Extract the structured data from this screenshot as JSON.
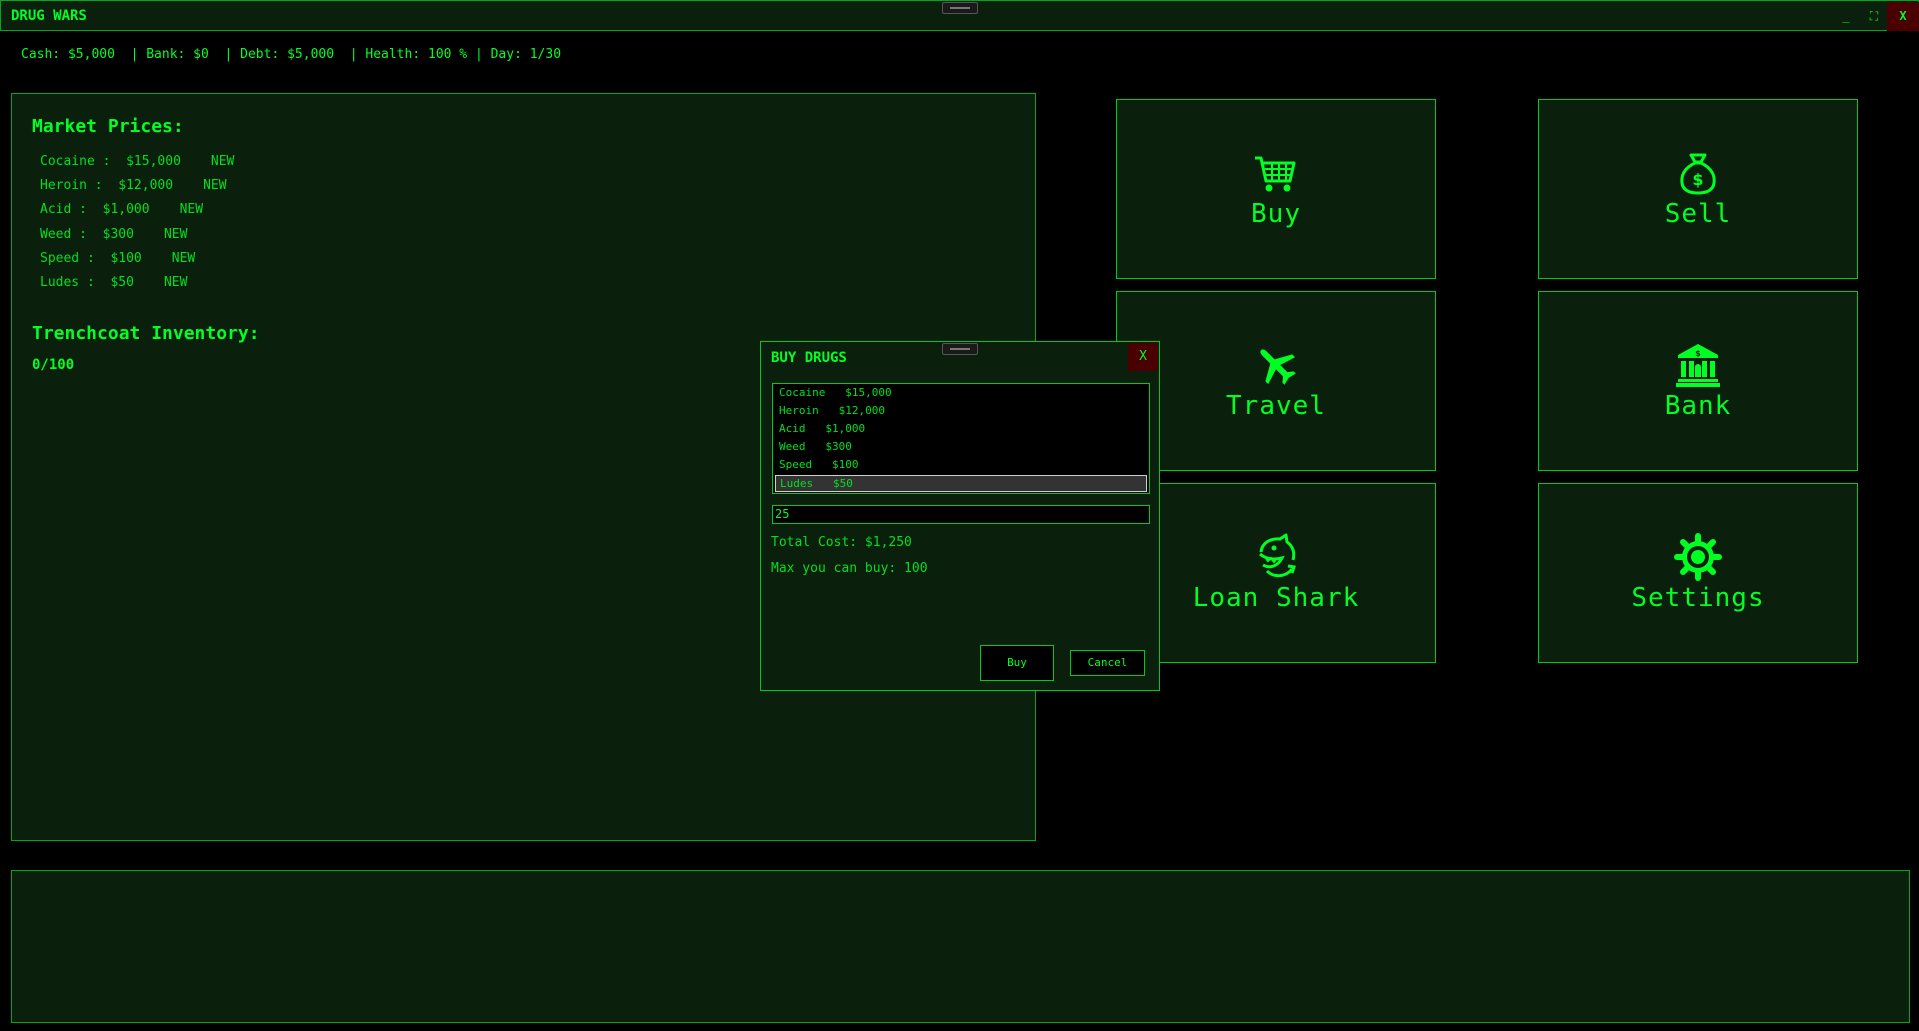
{
  "window": {
    "title": "DRUG WARS",
    "minimize_label": "_",
    "maximize_label": "⛶",
    "close_label": "X"
  },
  "status": {
    "text": "Cash: $5,000  | Bank: $0  | Debt: $5,000  | Health: 100 % | Day: 1/30"
  },
  "market": {
    "heading": "Market Prices:",
    "items": [
      {
        "name": "Cocaine :",
        "price": "$15,000",
        "tag": "NEW"
      },
      {
        "name": "Heroin :",
        "price": "$12,000",
        "tag": "NEW"
      },
      {
        "name": "Acid :",
        "price": "$1,000",
        "tag": "NEW"
      },
      {
        "name": "Weed :",
        "price": "$300",
        "tag": "NEW"
      },
      {
        "name": "Speed :",
        "price": "$100",
        "tag": "NEW"
      },
      {
        "name": "Ludes :",
        "price": "$50",
        "tag": "NEW"
      }
    ]
  },
  "inventory": {
    "heading": "Trenchcoat Inventory:",
    "count": "0/100"
  },
  "actions": {
    "buy": "Buy",
    "sell": "Sell",
    "travel": "Travel",
    "bank": "Bank",
    "loan_shark": "Loan Shark",
    "settings": "Settings"
  },
  "dialog": {
    "title": "BUY DRUGS",
    "close_label": "X",
    "list": [
      {
        "name": "Cocaine",
        "price": "$15,000"
      },
      {
        "name": "Heroin",
        "price": "$12,000"
      },
      {
        "name": "Acid",
        "price": "$1,000"
      },
      {
        "name": "Weed",
        "price": "$300"
      },
      {
        "name": "Speed",
        "price": "$100"
      },
      {
        "name": "Ludes",
        "price": "$50"
      }
    ],
    "selected_index": 5,
    "quantity": "25",
    "total_cost": "Total Cost: $1,250",
    "max_buy": "Max you can buy: 100",
    "buy_label": "Buy",
    "cancel_label": "Cancel"
  },
  "colors": {
    "accent": "#00ff22",
    "panel_bg": "#0b1f0d",
    "border": "#00a81a",
    "close_bg": "#4a0000"
  }
}
